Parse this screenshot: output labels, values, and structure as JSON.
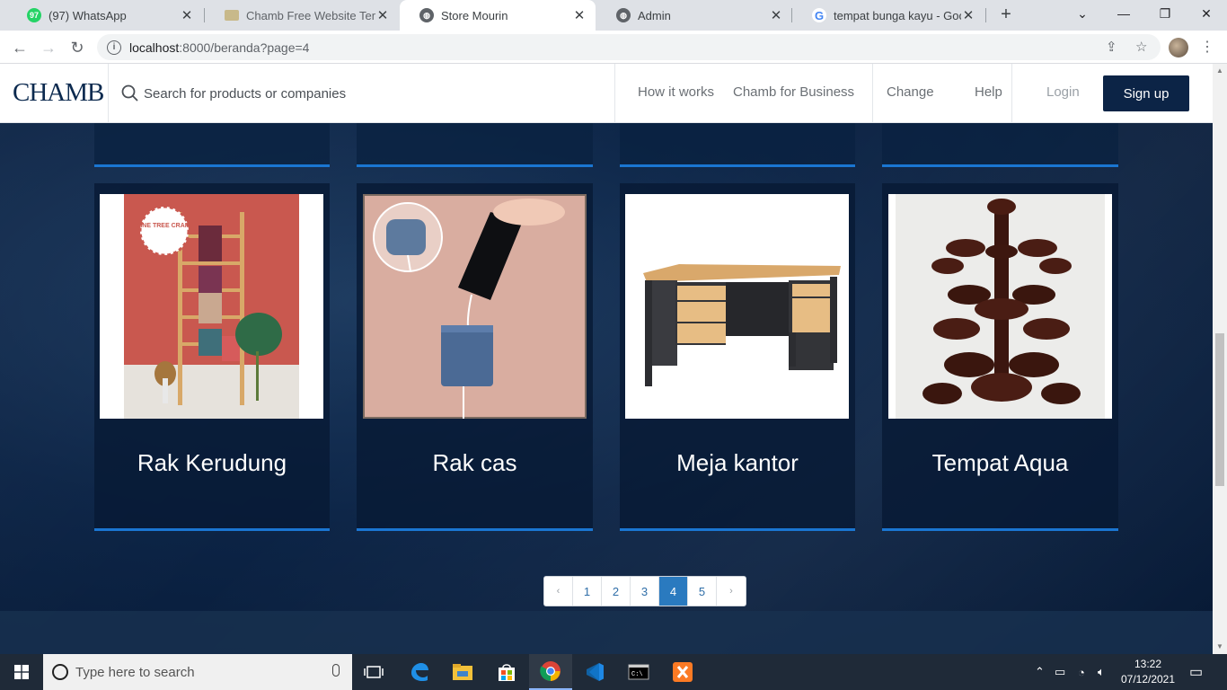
{
  "browser": {
    "tabs": [
      {
        "title": "(97) WhatsApp",
        "icon": "whatsapp-icon",
        "badge": "97"
      },
      {
        "title": "Chamb Free Website Templat",
        "icon": "template-icon"
      },
      {
        "title": "Store Mourin",
        "icon": "globe-icon"
      },
      {
        "title": "Admin",
        "icon": "globe-icon"
      },
      {
        "title": "tempat bunga kayu - Google",
        "icon": "google-icon"
      }
    ],
    "url_host": "localhost",
    "url_path": ":8000/beranda?page=4"
  },
  "site": {
    "logo": "CHAMB",
    "search_placeholder": "Search for products or companies",
    "nav": {
      "how_it_works": "How it works",
      "for_business": "Chamb for Business",
      "change": "Change",
      "help": "Help",
      "login": "Login",
      "signup": "Sign up"
    },
    "products": [
      {
        "name": "Rak Kerudung",
        "image": "scarf-rack-photo",
        "badge_text": "PINE TREE CRAFT"
      },
      {
        "name": "Rak cas",
        "image": "wall-charging-shelf-photo"
      },
      {
        "name": "Meja kantor",
        "image": "office-desk-photo"
      },
      {
        "name": "Tempat Aqua",
        "image": "carved-cup-holder-photo"
      }
    ],
    "pagination": {
      "prev": "‹",
      "pages": [
        "1",
        "2",
        "3",
        "4",
        "5"
      ],
      "current": "4",
      "next": "›"
    }
  },
  "taskbar": {
    "search_placeholder": "Type here to search",
    "time": "13:22",
    "date": "07/12/2021",
    "apps": [
      "task-view-icon",
      "edge-icon",
      "file-explorer-icon",
      "store-icon",
      "chrome-icon",
      "vscode-icon",
      "terminal-icon",
      "xampp-icon"
    ]
  },
  "colors": {
    "navy": "#0c2446",
    "accent_blue": "#1a76d2",
    "page_active": "#2a7abf"
  }
}
